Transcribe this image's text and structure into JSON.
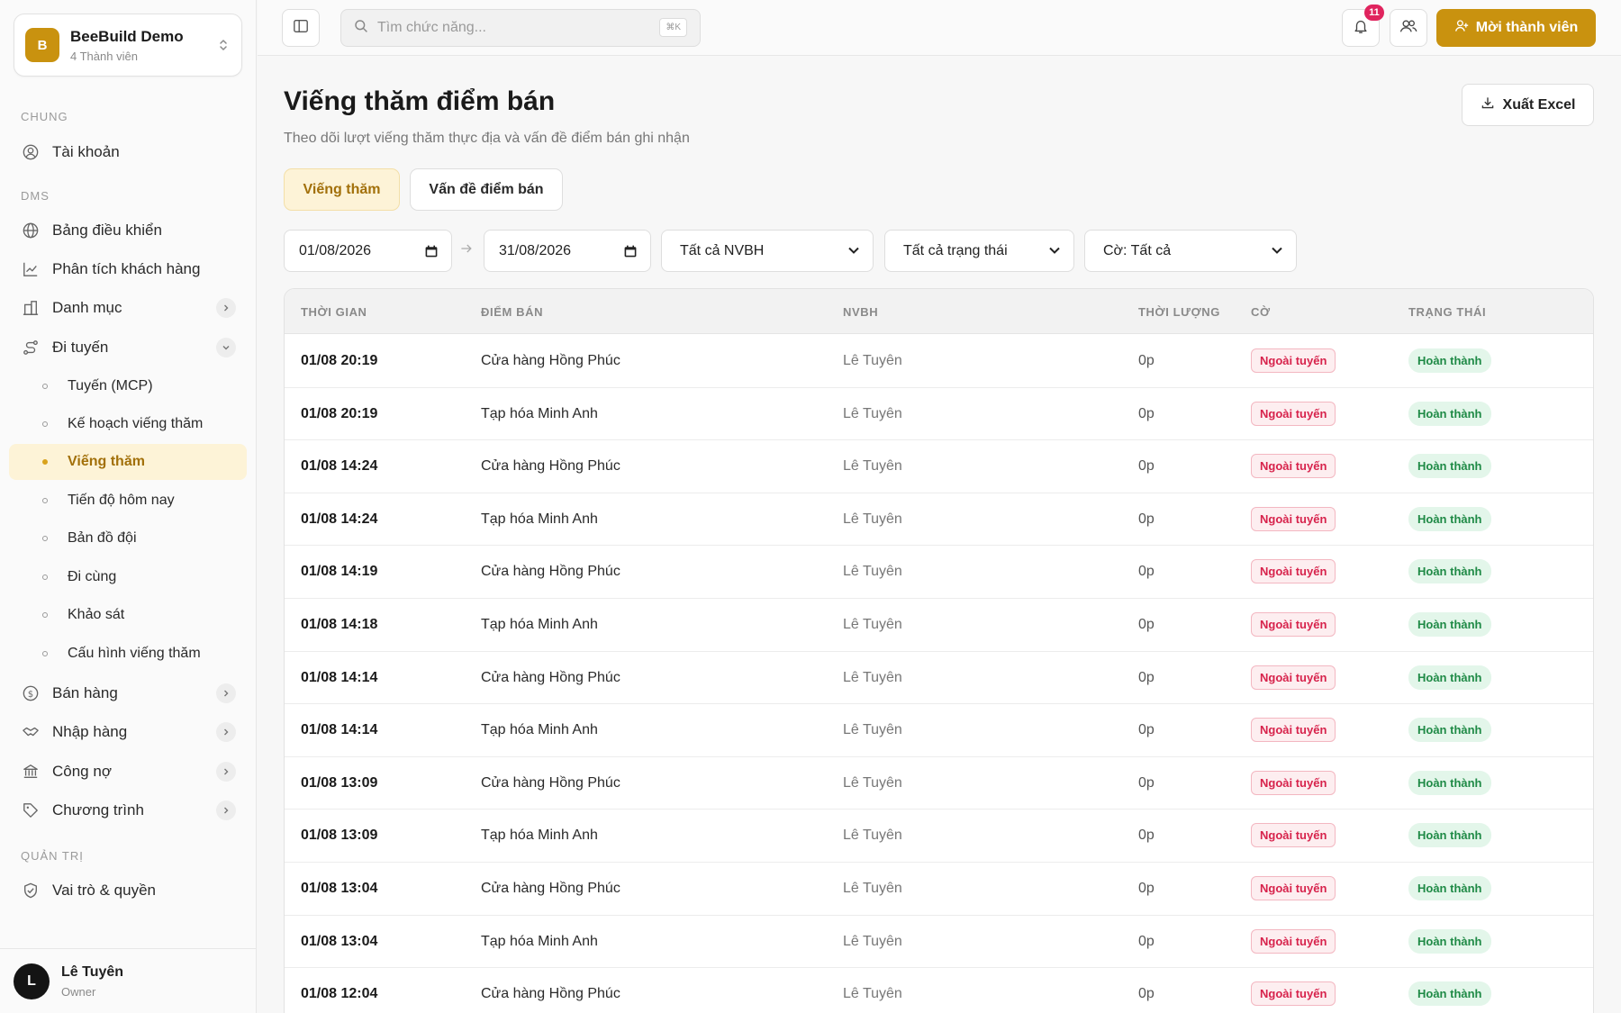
{
  "org": {
    "logo_letter": "B",
    "name": "BeeBuild Demo",
    "members": "4 Thành viên"
  },
  "sections": {
    "chung": "CHUNG",
    "dms": "DMS",
    "quan_tri": "QUẢN TRỊ"
  },
  "nav": {
    "account": "Tài khoản",
    "dashboard": "Bảng điều khiển",
    "customer_analysis": "Phân tích khách hàng",
    "catalog": "Danh mục",
    "routes": "Đi tuyến",
    "sub": {
      "mcp": "Tuyến (MCP)",
      "visit_plan": "Kế hoạch viếng thăm",
      "visits": "Viếng thăm",
      "today_progress": "Tiến độ hôm nay",
      "team_map": "Bản đồ đội",
      "ride_along": "Đi cùng",
      "survey": "Khảo sát",
      "visit_config": "Cấu hình viếng thăm"
    },
    "sales": "Bán hàng",
    "purchasing": "Nhập hàng",
    "debt": "Công nợ",
    "programs": "Chương trình",
    "roles": "Vai trò & quyền"
  },
  "user": {
    "initial": "L",
    "name": "Lê Tuyên",
    "role": "Owner"
  },
  "topbar": {
    "search_placeholder": "Tìm chức năng...",
    "search_shortcut": "⌘K",
    "notif_count": "11",
    "new_member_label": "Mời thành viên"
  },
  "page": {
    "title": "Viếng thăm điểm bán",
    "subtitle": "Theo dõi lượt viếng thăm thực địa và vấn đề điểm bán ghi nhận",
    "export_label": "Xuất Excel",
    "tabs": [
      "Viếng thăm",
      "Vấn đề điểm bán"
    ]
  },
  "filters": {
    "date_from": "01/08/2026",
    "date_to": "31/08/2026",
    "nvbh": "Tất cả NVBH",
    "status": "Tất cả trạng thái",
    "flag": "Cờ: Tất cả"
  },
  "table": {
    "headers": [
      "THỜI GIAN",
      "ĐIỂM BÁN",
      "NVBH",
      "THỜI LƯỢNG",
      "CỜ",
      "TRẠNG THÁI"
    ],
    "rows": [
      {
        "time": "01/08 20:19",
        "store": "Cửa hàng Hồng Phúc",
        "nvbh": "Lê Tuyên",
        "duration": "0p",
        "flag": "Ngoài tuyến",
        "status": "Hoàn thành"
      },
      {
        "time": "01/08 20:19",
        "store": "Tạp hóa Minh Anh",
        "nvbh": "Lê Tuyên",
        "duration": "0p",
        "flag": "Ngoài tuyến",
        "status": "Hoàn thành"
      },
      {
        "time": "01/08 14:24",
        "store": "Cửa hàng Hồng Phúc",
        "nvbh": "Lê Tuyên",
        "duration": "0p",
        "flag": "Ngoài tuyến",
        "status": "Hoàn thành"
      },
      {
        "time": "01/08 14:24",
        "store": "Tạp hóa Minh Anh",
        "nvbh": "Lê Tuyên",
        "duration": "0p",
        "flag": "Ngoài tuyến",
        "status": "Hoàn thành"
      },
      {
        "time": "01/08 14:19",
        "store": "Cửa hàng Hồng Phúc",
        "nvbh": "Lê Tuyên",
        "duration": "0p",
        "flag": "Ngoài tuyến",
        "status": "Hoàn thành"
      },
      {
        "time": "01/08 14:18",
        "store": "Tạp hóa Minh Anh",
        "nvbh": "Lê Tuyên",
        "duration": "0p",
        "flag": "Ngoài tuyến",
        "status": "Hoàn thành"
      },
      {
        "time": "01/08 14:14",
        "store": "Cửa hàng Hồng Phúc",
        "nvbh": "Lê Tuyên",
        "duration": "0p",
        "flag": "Ngoài tuyến",
        "status": "Hoàn thành"
      },
      {
        "time": "01/08 14:14",
        "store": "Tạp hóa Minh Anh",
        "nvbh": "Lê Tuyên",
        "duration": "0p",
        "flag": "Ngoài tuyến",
        "status": "Hoàn thành"
      },
      {
        "time": "01/08 13:09",
        "store": "Cửa hàng Hồng Phúc",
        "nvbh": "Lê Tuyên",
        "duration": "0p",
        "flag": "Ngoài tuyến",
        "status": "Hoàn thành"
      },
      {
        "time": "01/08 13:09",
        "store": "Tạp hóa Minh Anh",
        "nvbh": "Lê Tuyên",
        "duration": "0p",
        "flag": "Ngoài tuyến",
        "status": "Hoàn thành"
      },
      {
        "time": "01/08 13:04",
        "store": "Cửa hàng Hồng Phúc",
        "nvbh": "Lê Tuyên",
        "duration": "0p",
        "flag": "Ngoài tuyến",
        "status": "Hoàn thành"
      },
      {
        "time": "01/08 13:04",
        "store": "Tạp hóa Minh Anh",
        "nvbh": "Lê Tuyên",
        "duration": "0p",
        "flag": "Ngoài tuyến",
        "status": "Hoàn thành"
      },
      {
        "time": "01/08 12:04",
        "store": "Cửa hàng Hồng Phúc",
        "nvbh": "Lê Tuyên",
        "duration": "0p",
        "flag": "Ngoài tuyến",
        "status": "Hoàn thành"
      }
    ]
  },
  "colors": {
    "accent": "#c9920f",
    "active_bg": "#fdf3d7",
    "flag_red": "#d7234c",
    "status_green": "#1f8a46"
  }
}
